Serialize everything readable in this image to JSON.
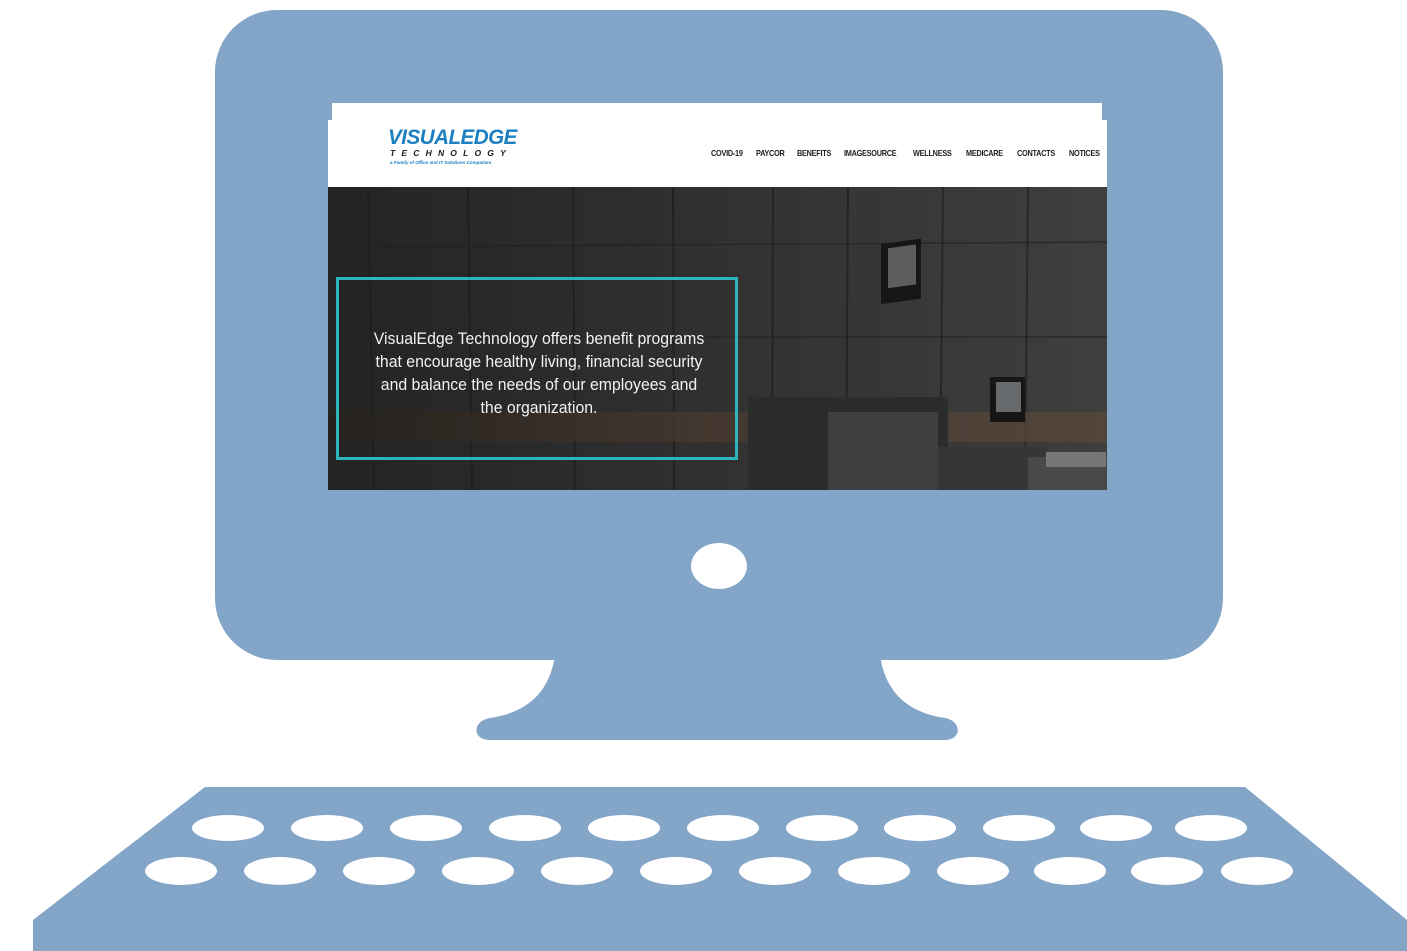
{
  "site": {
    "logo": {
      "main": "VISUALEDGE",
      "sub": "TECHNOLOGY",
      "tagline": "a Family of Office and IT Solutions Companies"
    },
    "nav": [
      "COVID-19",
      "PAYCOR",
      "BENEFITS",
      "IMAGESOURCE",
      "WELLNESS",
      "MEDICARE",
      "CONTACTS",
      "NOTICES"
    ],
    "hero": {
      "text": "VisualEdge Technology offers benefit programs that encourage healthy living, financial security and balance the needs of our employees and the organization."
    }
  },
  "colors": {
    "illustration": "#82a5c8",
    "brand_blue": "#1c7fc0",
    "accent_teal": "#2fb4bb"
  }
}
